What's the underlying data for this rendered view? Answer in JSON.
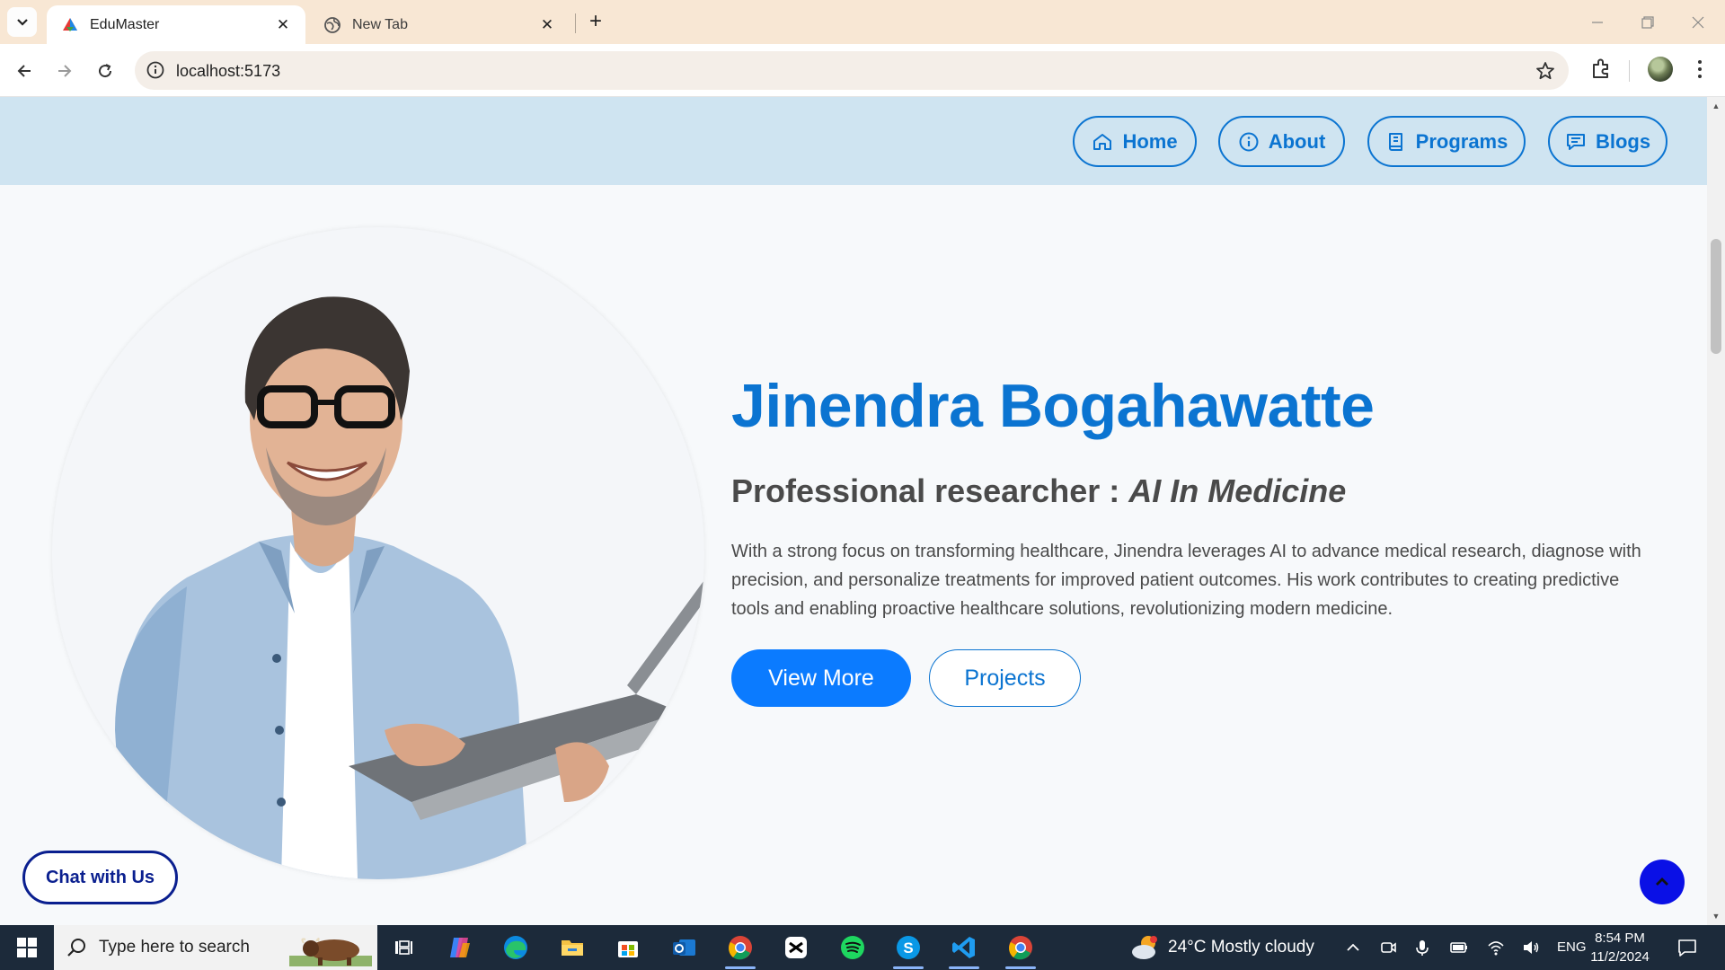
{
  "browser": {
    "tabs": [
      {
        "title": "EduMaster",
        "active": true
      },
      {
        "title": "New Tab",
        "active": false
      }
    ],
    "url": "localhost:5173"
  },
  "site": {
    "nav": [
      {
        "label": "Home",
        "icon": "home-icon"
      },
      {
        "label": "About",
        "icon": "info-icon"
      },
      {
        "label": "Programs",
        "icon": "book-icon"
      },
      {
        "label": "Blogs",
        "icon": "message-icon"
      }
    ],
    "hero": {
      "name": "Jinendra Bogahawatte",
      "role_prefix": "Professional researcher : ",
      "role_field": "AI In Medicine",
      "description": "With a strong focus on transforming healthcare, Jinendra leverages AI to advance medical research, diagnose with precision, and personalize treatments for improved patient outcomes. His work contributes to creating predictive tools and enabling proactive healthcare solutions, revolutionizing modern medicine.",
      "primary_button": "View More",
      "secondary_button": "Projects"
    },
    "chat_button": "Chat with Us",
    "scroll_top_icon": "chevron-up-icon",
    "colors": {
      "accent": "#0b74d1",
      "primary_button": "#0b7bff",
      "header_bg": "#cfe4f1",
      "chat": "#0a1f8f"
    }
  },
  "taskbar": {
    "search_placeholder": "Type here to search",
    "weather": "24°C  Mostly cloudy",
    "language": "ENG",
    "time": "8:54 PM",
    "date": "11/2/2024"
  }
}
